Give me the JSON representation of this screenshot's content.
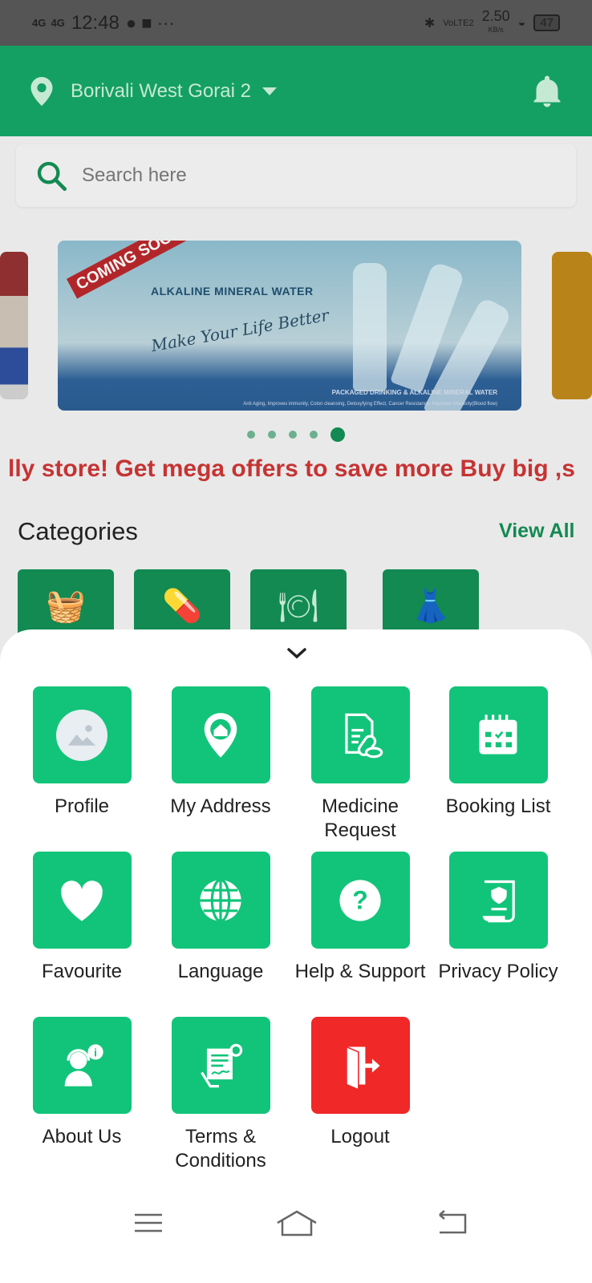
{
  "status_bar": {
    "network1": "4G",
    "network2": "4G",
    "time": "12:48",
    "more": "···",
    "volte": "VoLTE2",
    "speed": "2.50",
    "speed_unit": "KB/s",
    "battery": "47"
  },
  "header": {
    "location": "Borivali West Gorai 2",
    "icons": [
      "location-pin-icon",
      "caret-down-icon",
      "bell-icon"
    ]
  },
  "search": {
    "placeholder": "Search here"
  },
  "banner": {
    "tag": "COMING SOON",
    "title": "ALKALINE MINERAL WATER",
    "slogan": "Make Your Life Better",
    "caption": "PACKAGED DRINKING & ALKALINE MINERAL WATER",
    "features": "Anti Aging, Improves immunity, Colon cleansing, Detoxyfying Effect, Cancer Resistance, Improves Viscosity(Blood flow)",
    "slide_count": 5,
    "active_slide": 5
  },
  "marquee": "lly store! Get mega offers to save more Buy big ,s",
  "categories": {
    "title": "Categories",
    "view_all": "View All",
    "icons": [
      "grocery-basket-icon",
      "medicine-icon",
      "restaurant-icon",
      "clothing-icon"
    ]
  },
  "menu": {
    "items": [
      {
        "label": "Profile",
        "icon": "profile-image-icon"
      },
      {
        "label": "My Address",
        "icon": "home-pin-icon"
      },
      {
        "label": "Medicine Request",
        "icon": "prescription-icon"
      },
      {
        "label": "Booking List",
        "icon": "calendar-icon"
      },
      {
        "label": "Favourite",
        "icon": "heart-icon"
      },
      {
        "label": "Language",
        "icon": "globe-icon"
      },
      {
        "label": "Help & Support",
        "icon": "question-icon"
      },
      {
        "label": "Privacy Policy",
        "icon": "shield-document-icon"
      },
      {
        "label": "About Us",
        "icon": "support-agent-icon"
      },
      {
        "label": "Terms & Conditions",
        "icon": "contract-icon"
      },
      {
        "label": "Logout",
        "icon": "logout-door-icon"
      }
    ]
  },
  "colors": {
    "primary": "#12c47a",
    "header": "#14a062",
    "logout": "#f02828",
    "marquee": "#c63333"
  }
}
